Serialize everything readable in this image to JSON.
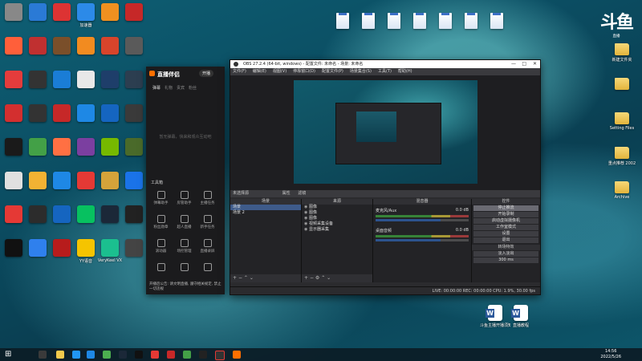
{
  "desktop": {
    "left_icons": [
      {
        "label": "",
        "color": "#888"
      },
      {
        "label": "",
        "color": "#2a7ad6"
      },
      {
        "label": "",
        "color": "#d33"
      },
      {
        "label": "加速器",
        "color": "#2c8ae8"
      },
      {
        "label": "",
        "color": "#f09020"
      },
      {
        "label": "",
        "color": "#c62828"
      },
      {
        "label": "",
        "color": "#ff5f3a"
      },
      {
        "label": "",
        "color": "#c03030"
      },
      {
        "label": "",
        "color": "#7a4f2a"
      },
      {
        "label": "",
        "color": "#f28b20"
      },
      {
        "label": "",
        "color": "#d8442b"
      },
      {
        "label": "",
        "color": "#5a5a5a"
      },
      {
        "label": "",
        "color": "#e43c3c"
      },
      {
        "label": "",
        "color": "#333"
      },
      {
        "label": "",
        "color": "#1a7dd6"
      },
      {
        "label": "",
        "color": "#e8e8e8"
      },
      {
        "label": "",
        "color": "#1e3e6a"
      },
      {
        "label": "",
        "color": "#2c3e50"
      },
      {
        "label": "",
        "color": "#d32f2f"
      },
      {
        "label": "",
        "color": "#333"
      },
      {
        "label": "",
        "color": "#c62828"
      },
      {
        "label": "",
        "color": "#1e88e5"
      },
      {
        "label": "",
        "color": "#1565c0"
      },
      {
        "label": "",
        "color": "#3a3a3a"
      },
      {
        "label": "",
        "color": "#1a1a1a"
      },
      {
        "label": "",
        "color": "#43a047"
      },
      {
        "label": "",
        "color": "#ff7043"
      },
      {
        "label": "",
        "color": "#7b3fa0"
      },
      {
        "label": "",
        "color": "#76b900"
      },
      {
        "label": "",
        "color": "#4a6a2a"
      },
      {
        "label": "",
        "color": "#e0e0e0"
      },
      {
        "label": "",
        "color": "#f2b233"
      },
      {
        "label": "",
        "color": "#1e88e5"
      },
      {
        "label": "",
        "color": "#e53935"
      },
      {
        "label": "",
        "color": "#d4a33a"
      },
      {
        "label": "",
        "color": "#1a73e8"
      },
      {
        "label": "",
        "color": "#e53935"
      },
      {
        "label": "",
        "color": "#2c2c2c"
      },
      {
        "label": "",
        "color": "#1565c0"
      },
      {
        "label": "",
        "color": "#07c160"
      },
      {
        "label": "",
        "color": "#1b2838"
      },
      {
        "label": "",
        "color": "#222"
      },
      {
        "label": "",
        "color": "#111"
      },
      {
        "label": "",
        "color": "#2f80ed"
      },
      {
        "label": "",
        "color": "#b71c1c"
      },
      {
        "label": "YY语音",
        "color": "#f5c400"
      },
      {
        "label": "VeryKeel VX",
        "color": "#1bbf8f"
      },
      {
        "label": "",
        "color": "#444"
      }
    ],
    "top_files": [
      "",
      "",
      "",
      "",
      "",
      "",
      ""
    ],
    "right_folders": [
      "新建文件夹",
      "",
      "Setting Files",
      "重点推荐 2002",
      "Archive"
    ],
    "bottom_docs": [
      "斗鱼主播开播须知",
      "直播教程"
    ]
  },
  "obs": {
    "title": "OBS 27.2.4 (64-bit, windows) - 配置文件: 未命名 - 场景: 未命名",
    "menu": [
      "文件(F)",
      "编辑(E)",
      "视图(V)",
      "停靠窗口(D)",
      "配置文件(P)",
      "场景集合(S)",
      "工具(T)",
      "帮助(H)"
    ],
    "strip_label": "未选择源",
    "strip_buttons": [
      "属性",
      "滤镜"
    ],
    "scenes_header": "场景",
    "scenes": [
      "场景",
      "场景 2"
    ],
    "sources_header": "来源",
    "sources": [
      "图像",
      "图像",
      "图像",
      "视频采集设备",
      "显示器采集"
    ],
    "mixer_header": "混音器",
    "mixer": [
      {
        "name": "麦克风/Aux",
        "db": "0.0 dB"
      },
      {
        "name": "桌面音频",
        "db": "0.0 dB"
      }
    ],
    "transitions_header": "转场特效",
    "transition_select": "淡入淡出",
    "transition_duration": "300 ms",
    "controls_header": "控件",
    "controls": [
      "停止推流",
      "开始录制",
      "启动虚拟摄像机",
      "工作室模式",
      "设置",
      "退出"
    ],
    "status": "LIVE: 00:00:00   REC: 00:00:00   CPU: 1.9%, 30.00 fps"
  },
  "douyu": {
    "brand": "直播伴侣",
    "pill": "开播",
    "tabs": [
      "弹幕",
      "礼物",
      "贵宾",
      "粉丝"
    ],
    "empty": "暂无弹幕，快来和观众互动吧",
    "tools_title": "工具箱",
    "tools": [
      "弹幕助手",
      "房管助手",
      "主播任务",
      "粉丝勋章",
      "超人直播",
      "新手任务",
      "滚动器",
      "场控管理",
      "直播录屏",
      "",
      "",
      ""
    ],
    "notice": "开播后公告: 请文明直播, 遵守相关规定, 禁止一切违规"
  },
  "watermark": {
    "logo": "斗鱼",
    "sub": "直播"
  },
  "clock": {
    "time": "14:56",
    "date": "2022/5/26"
  }
}
